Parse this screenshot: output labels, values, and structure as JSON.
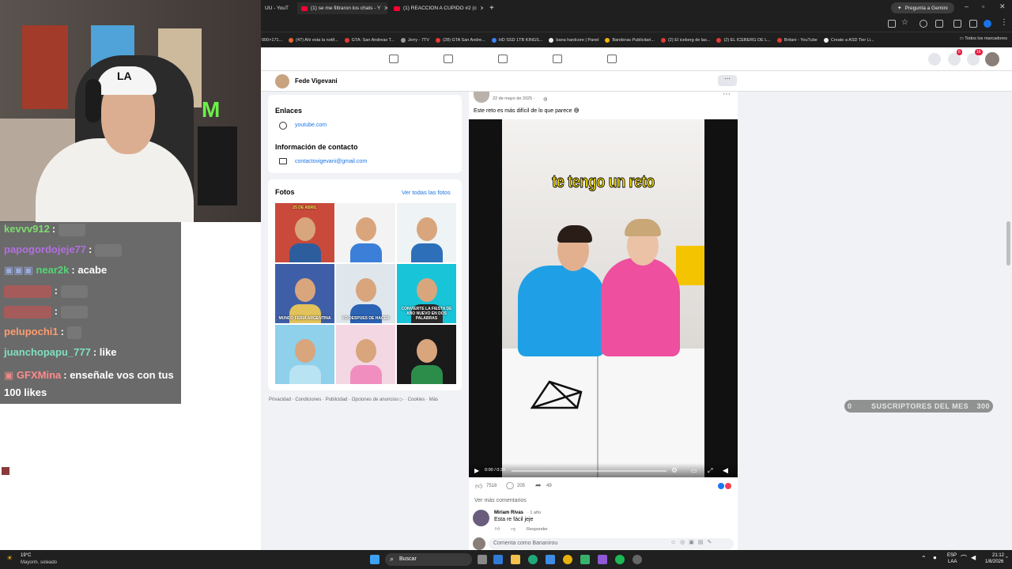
{
  "browser": {
    "tabs": [
      {
        "title": "UU - YouT"
      },
      {
        "title": "(1) se me filtraron los chats - Y"
      },
      {
        "title": "(1) REACCION A CUPIDO #2 (c"
      }
    ],
    "new_tab": "+",
    "gemini_button": "Pregunta a Gemini",
    "bookmarks": [
      "000×171...",
      "(47) Ahí esta la notif...",
      "GTA: San Andreas T...",
      "Jerry - 7TV",
      "(28) GTA San Andre...",
      "HD SSD 1TB KINGS...",
      "bana hardcore | Panel",
      "Banderas Publicitari...",
      "(2) El iceberg de las...",
      "(2) EL ICEBERG DE L...",
      "Britani - YouTube",
      "Create a ASD Tier Li..."
    ],
    "all_bookmarks": "Todos los marcadores"
  },
  "facebook": {
    "badges": {
      "messenger": "6",
      "notifications": "16"
    },
    "page_name": "Fede Vigevani",
    "more": "···",
    "links_heading": "Enlaces",
    "link_youtube": "youtube.com",
    "contact_heading": "Información de contacto",
    "contact_email": "contactovigevani@gmail.com",
    "photos_heading": "Fotos",
    "photos_see_all": "Ver todas las fotos",
    "photo_captions": [
      "25 DE ABRIL",
      "",
      "",
      "MUNDO FERIA ARGENTINA",
      "YO DESPUES DE HACER",
      "CONVIERTE LA FIESTA DE AÑO NUEVO EN DOS PALABRAS",
      "",
      "",
      ""
    ],
    "footer": "Privacidad · Condiciones · Publicidad · Opciones de anuncios ▷ · Cookies · Más"
  },
  "post": {
    "date": "22 de mayo de 2025 · ",
    "text": "Este reto es más difícil de lo que parece 😅",
    "video_overlay_text": "te tengo un reto",
    "video_time": "0:00 / 0:39",
    "video_progress": 0,
    "likes": "7518",
    "comments": "205",
    "shares": "49",
    "see_more_comments": "Ver más comentarios",
    "comment_author": "Miriam Rivas",
    "comment_age": "· 1 año",
    "comment_text": "Esta re fácil jeje",
    "comment_reply": "Responder",
    "comment_input_placeholder": "Comenta como Bananirou"
  },
  "stream": {
    "chat": [
      {
        "user": "kevvv912",
        "msg": "",
        "color": "#7fdc6e"
      },
      {
        "user": "papogordojeje77",
        "msg": "",
        "color": "#b36ee3"
      },
      {
        "user": "near2k",
        "msg": "acabe",
        "color": "#53d675"
      },
      {
        "user": "",
        "msg": "",
        "color": "#ff5d5d"
      },
      {
        "user": "",
        "msg": "",
        "color": "#ff5d5d"
      },
      {
        "user": "pelupochi1",
        "msg": "",
        "color": "#ff9c6e"
      },
      {
        "user": "juanchopapu_777",
        "msg": "like",
        "color": "#7fe0c0"
      },
      {
        "user": "GFXMina",
        "msg": "enseñale vos con tus 100 likes",
        "color": "#ff8b8b"
      }
    ],
    "subs_label": "SUSCRIPTORES DEL MES",
    "subs_min": "0",
    "subs_max": "300"
  },
  "taskbar": {
    "weather_temp": "19°C",
    "weather_desc": "Mayorm. soleado",
    "search": "Buscar",
    "lang": "ESP",
    "lang2": "LAA",
    "time": "21:12",
    "date": "1/8/2026"
  }
}
